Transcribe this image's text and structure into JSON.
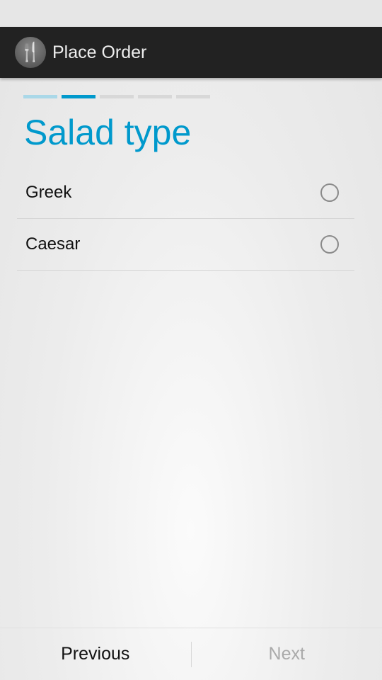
{
  "app": {
    "title": "Place Order",
    "icon": "fork-knife-icon"
  },
  "progress": {
    "total_steps": 5,
    "current_step": 2,
    "colors": {
      "done": "#aad8e8",
      "current": "#0099cc",
      "pending": "#d8d8d8"
    }
  },
  "page": {
    "title": "Salad type"
  },
  "options": [
    {
      "label": "Greek",
      "selected": false
    },
    {
      "label": "Caesar",
      "selected": false
    }
  ],
  "footer": {
    "previous": "Previous",
    "next": "Next",
    "next_enabled": false
  }
}
